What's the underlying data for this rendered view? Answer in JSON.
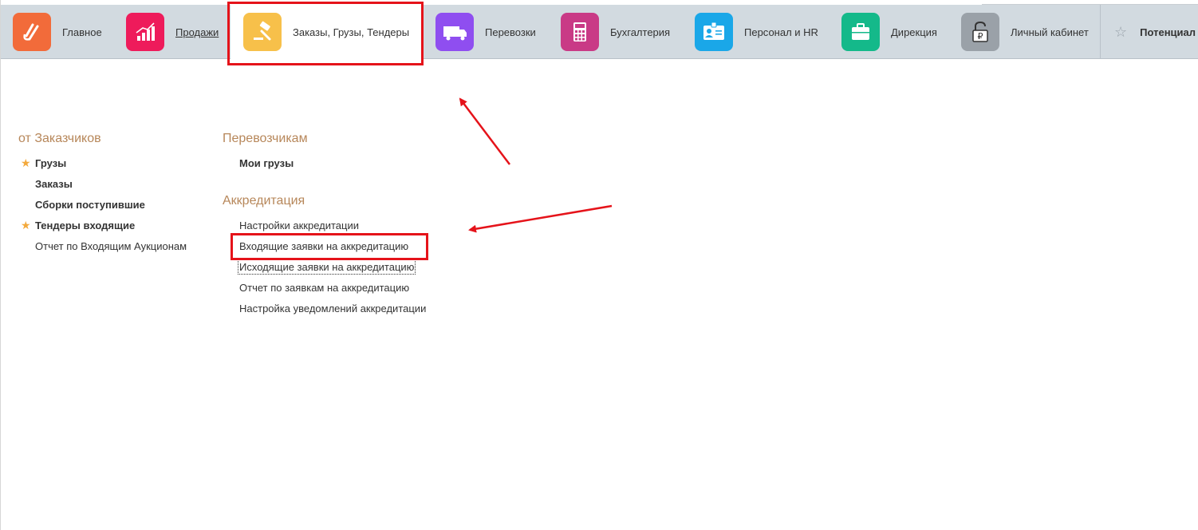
{
  "nav": {
    "items": [
      {
        "label": "Главное",
        "icon": "logo-icon",
        "color": "#f26b3a"
      },
      {
        "label": "Продажи",
        "icon": "sales-chart-icon",
        "color": "#ee1b5b"
      },
      {
        "label": "Заказы,  Грузы, Тендеры",
        "icon": "gavel-icon",
        "color": "#f7c04a"
      },
      {
        "label": "Перевозки",
        "icon": "truck-icon",
        "color": "#8f4ef0"
      },
      {
        "label": "Бухгалтерия",
        "icon": "calculator-icon",
        "color": "#c93a86"
      },
      {
        "label": "Персонал и HR",
        "icon": "id-card-icon",
        "color": "#1aa7e8"
      },
      {
        "label": "Дирекция",
        "icon": "briefcase-icon",
        "color": "#14b98a"
      },
      {
        "label": "Личный кабинет",
        "icon": "ruble-lock-icon",
        "color": "#9aa1a8"
      }
    ],
    "favorites_label": "Потенциал"
  },
  "left_section": {
    "title": "от Заказчиков",
    "items": [
      {
        "label": "Грузы",
        "starred": true
      },
      {
        "label": "Заказы",
        "starred": false
      },
      {
        "label": "Сборки поступившие",
        "starred": false
      },
      {
        "label": "Тендеры входящие",
        "starred": true
      },
      {
        "label": "Отчет по Входящим Аукционам",
        "starred": false
      }
    ]
  },
  "carriers_section": {
    "title": "Перевозчикам",
    "items": [
      {
        "label": "Мои грузы"
      }
    ]
  },
  "accreditation_section": {
    "title": "Аккредитация",
    "items": [
      {
        "label": "Настройки аккредитации"
      },
      {
        "label": "Входящие заявки на аккредитацию"
      },
      {
        "label": "Исходящие заявки на аккредитацию"
      },
      {
        "label": "Отчет по заявкам на аккредитацию"
      },
      {
        "label": "Настройка уведомлений аккредитации"
      }
    ]
  },
  "colors": {
    "nav_bg": "#d2dae0",
    "section_title": "#b7875a",
    "star": "#f3a93c",
    "annotation_red": "#e5131a"
  }
}
